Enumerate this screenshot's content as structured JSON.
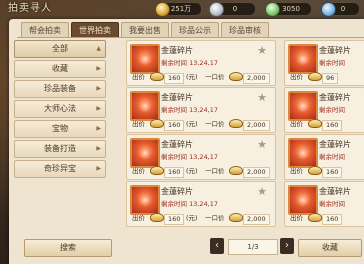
{
  "header": {
    "title": "拍卖寻人",
    "currencies": [
      {
        "icon": "gold-coin-icon",
        "value": "251万"
      },
      {
        "icon": "silver-coin-icon",
        "value": "0"
      },
      {
        "icon": "jade-coin-icon",
        "value": "3050"
      },
      {
        "icon": "pearl-coin-icon",
        "value": "0"
      }
    ]
  },
  "tabs": [
    {
      "label": "帮会拍卖",
      "active": false
    },
    {
      "label": "世界拍卖",
      "active": true
    },
    {
      "label": "我要出售",
      "active": false
    },
    {
      "label": "珍品公示",
      "active": false
    },
    {
      "label": "珍品审核",
      "active": false
    }
  ],
  "categories": [
    {
      "label": "全部",
      "active": true
    },
    {
      "label": "收藏",
      "active": false
    },
    {
      "label": "珍品装备",
      "active": false
    },
    {
      "label": "大师心法",
      "active": false
    },
    {
      "label": "宝物",
      "active": false
    },
    {
      "label": "装备打造",
      "active": false
    },
    {
      "label": "奇珍异宝",
      "active": false
    }
  ],
  "listings_left": [
    {
      "name": "金蓮碎片",
      "remain_label": "剩余时间",
      "remain": "13,24,17",
      "bid_label": "出价",
      "bid": "160",
      "unit": "(元)",
      "buyout_label": "一口价",
      "buyout": "2,000"
    },
    {
      "name": "金蓮碎片",
      "remain_label": "剩余时间",
      "remain": "13,24,17",
      "bid_label": "出价",
      "bid": "160",
      "unit": "(元)",
      "buyout_label": "一口价",
      "buyout": "2,000"
    },
    {
      "name": "金蓮碎片",
      "remain_label": "剩余时间",
      "remain": "13,24,17",
      "bid_label": "出价",
      "bid": "160",
      "unit": "(元)",
      "buyout_label": "一口价",
      "buyout": "2,000"
    },
    {
      "name": "金蓮碎片",
      "remain_label": "剩余时间",
      "remain": "13,24,17",
      "bid_label": "出价",
      "bid": "160",
      "unit": "(元)",
      "buyout_label": "一口价",
      "buyout": "2,000"
    }
  ],
  "listings_right": [
    {
      "name": "金蓮碎片",
      "remain": "剩余时间",
      "bid_label": "出价",
      "bid": "96"
    },
    {
      "name": "金蓮碎片",
      "remain": "剩余时间",
      "bid_label": "出价",
      "bid": "160"
    },
    {
      "name": "金蓮碎片",
      "remain": "剩余时间",
      "bid_label": "出价",
      "bid": "160"
    },
    {
      "name": "金蓮碎片",
      "remain": "剩余时间",
      "bid_label": "出价",
      "bid": "160"
    }
  ],
  "footer": {
    "search_label": "搜索",
    "page": "1/3",
    "favorites_label": "收藏"
  }
}
